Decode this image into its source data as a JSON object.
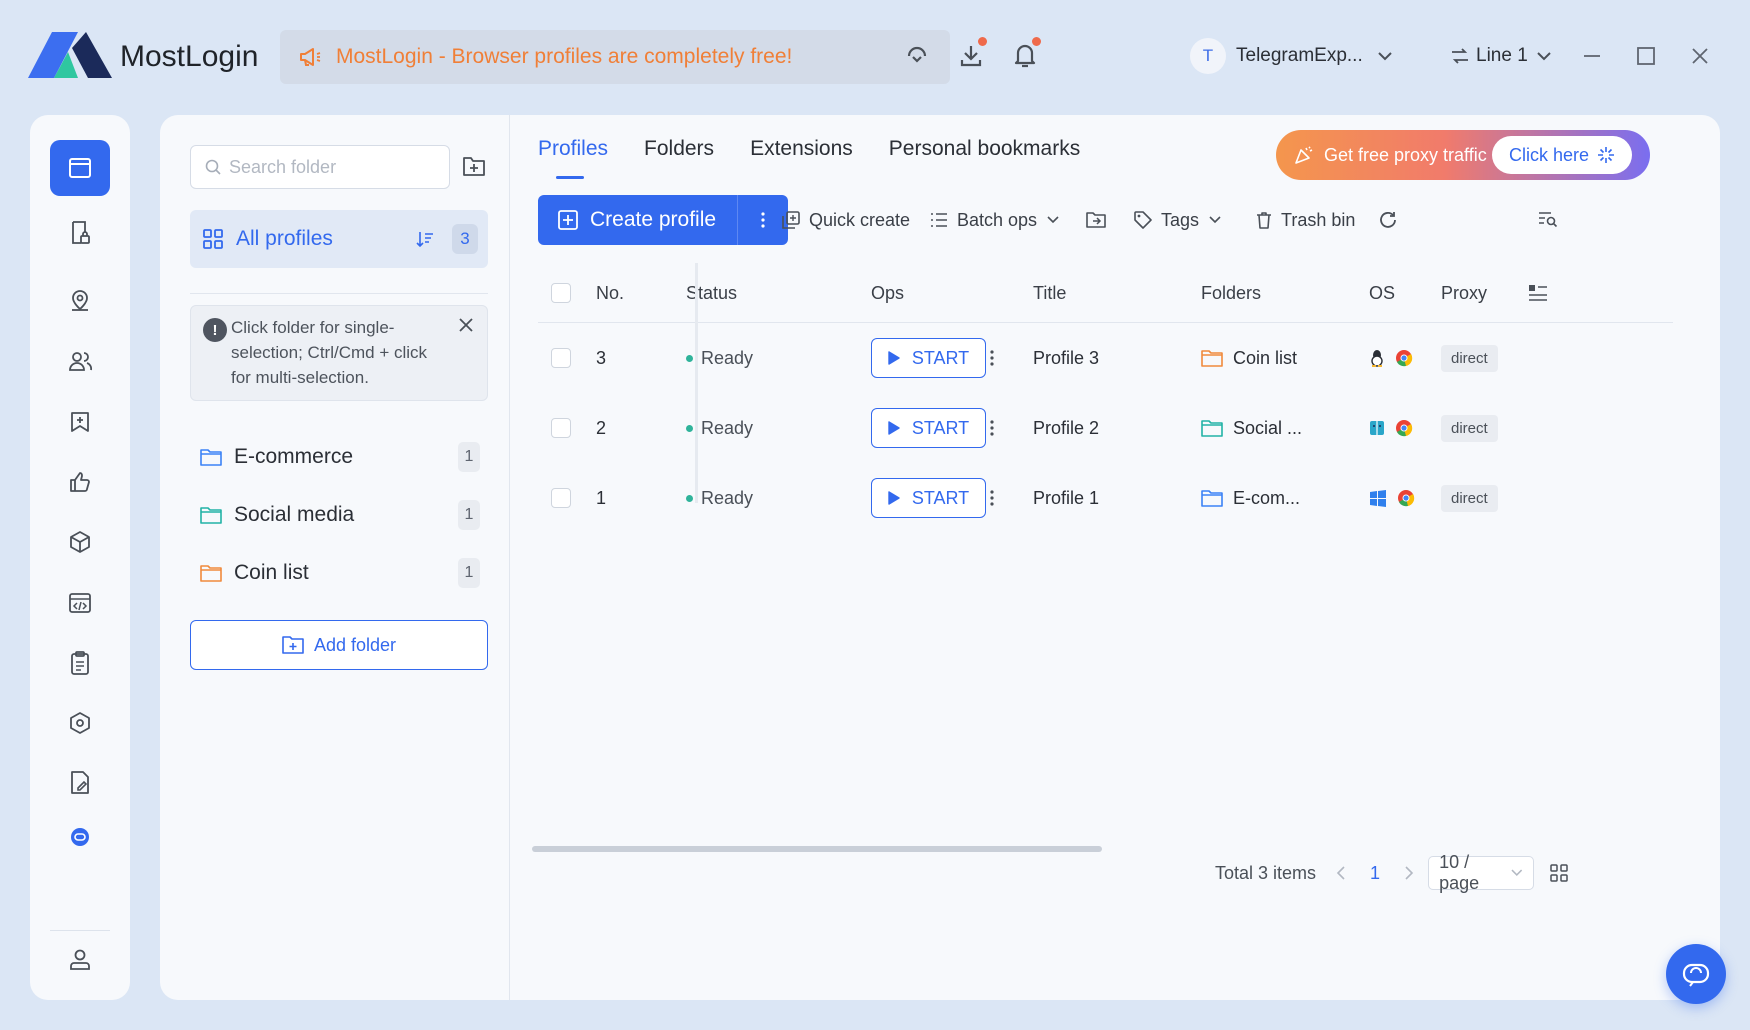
{
  "app": {
    "name": "MostLogin",
    "announcement": "MostLogin - Browser profiles are completely free!",
    "user": {
      "initial": "T",
      "name": "TelegramExp..."
    },
    "line": "Line 1",
    "colors": {
      "accent": "#3369ee",
      "announce": "#f07f37",
      "ready": "#2fb39a"
    }
  },
  "sidebar": {
    "search_placeholder": "Search folder",
    "all_profiles": {
      "label": "All profiles",
      "count": "3"
    },
    "tip": "Click folder for single-selection; Ctrl/Cmd + click for multi-selection.",
    "folders": [
      {
        "name": "E-commerce",
        "count": "1",
        "color": "#3b82f6"
      },
      {
        "name": "Social media",
        "count": "1",
        "color": "#22b3a6"
      },
      {
        "name": "Coin list",
        "count": "1",
        "color": "#f08a3c"
      }
    ],
    "add_folder": "Add folder"
  },
  "tabs": [
    "Profiles",
    "Folders",
    "Extensions",
    "Personal bookmarks"
  ],
  "promo": {
    "text": "Get free proxy traffic",
    "button": "Click here"
  },
  "toolbar": {
    "create": "Create profile",
    "quick_create": "Quick create",
    "batch_ops": "Batch ops",
    "tags": "Tags",
    "trash": "Trash bin"
  },
  "table": {
    "headers": {
      "no": "No.",
      "status": "Status",
      "ops": "Ops",
      "title": "Title",
      "folders": "Folders",
      "os": "OS",
      "proxy": "Proxy"
    },
    "rows": [
      {
        "no": "3",
        "status": "Ready",
        "start": "START",
        "title": "Profile 3",
        "folder": "Coin list",
        "folder_color": "#f08a3c",
        "os": "linux-icon",
        "proxy": "direct"
      },
      {
        "no": "2",
        "status": "Ready",
        "start": "START",
        "title": "Profile 2",
        "folder": "Social ...",
        "folder_color": "#22b3a6",
        "os": "macos-icon",
        "proxy": "direct"
      },
      {
        "no": "1",
        "status": "Ready",
        "start": "START",
        "title": "Profile 1",
        "folder": "E-com...",
        "folder_color": "#3b82f6",
        "os": "windows-icon",
        "proxy": "direct"
      }
    ]
  },
  "pagination": {
    "total": "Total 3 items",
    "current": "1",
    "page_size": "10 / page"
  }
}
